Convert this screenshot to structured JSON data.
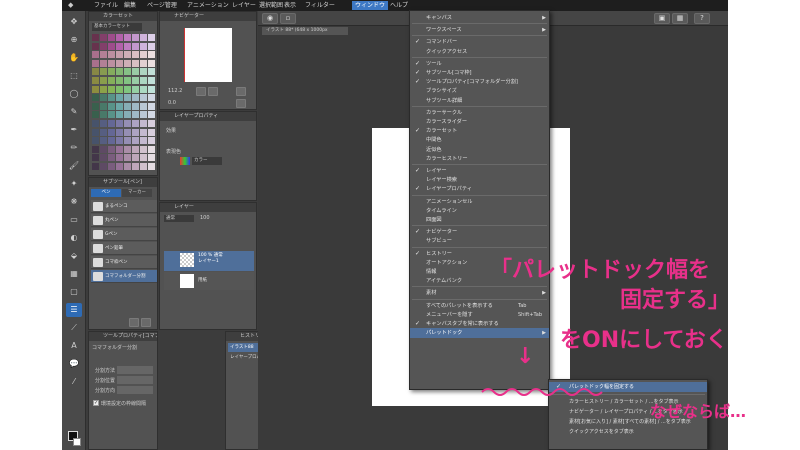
{
  "menubar": {
    "items": [
      "ファイル",
      "編集",
      "ページ管理",
      "アニメーション",
      "レイヤー",
      "選択範囲",
      "表示",
      "フィルター",
      "ウィンドウ",
      "ヘルプ"
    ],
    "active_index": 8
  },
  "canvas": {
    "tab_label": "イラスト 88* (648 x 1000px"
  },
  "left_panels": {
    "color_set_title": "カラーセット",
    "color_set_dropdown": "基本カラーセット",
    "sub_tool_title": "サブツール[ペン]",
    "sub_tool_tabs": [
      "ペン",
      "マーカー"
    ],
    "sub_tool_items": [
      "まるペンコ",
      "丸ペン",
      "Gペン",
      "ペン鉛筆",
      "コマ枠ペン",
      "コマフォルダー分割"
    ],
    "tool_property_title": "ツールプロパティ[コマフォルダー分割]",
    "tool_property_name": "コマフォルダー分割",
    "tool_property_rows": [
      "分割方法",
      "分割位置",
      "分割方向"
    ],
    "tool_property_checkbox": "環境設定の枠線間隔",
    "navigator_title": "ナビゲーター",
    "zoom_value": "112.2",
    "rotation_value": "0.0",
    "layer_property_title": "レイヤープロパティ",
    "layer_property_labels": [
      "効果",
      "表現色"
    ],
    "layer_property_color": "カラー",
    "layer_title": "レイヤー",
    "layer_blend": "通常",
    "layer_opacity": "100",
    "layers": [
      {
        "name": "100 % 通常\nレイヤー1"
      },
      {
        "name": "用紙"
      }
    ],
    "history_title": "ヒストリー",
    "history_items": [
      "イラスト88",
      "レイヤープロパティの変更"
    ]
  },
  "window_menu": {
    "items": [
      {
        "label": "キャンバス",
        "checked": false,
        "submenu": true
      },
      {
        "sep": true
      },
      {
        "label": "ワークスペース",
        "checked": false,
        "submenu": true
      },
      {
        "sep": true
      },
      {
        "label": "コマンドバー",
        "checked": true
      },
      {
        "label": "クイックアクセス",
        "checked": false
      },
      {
        "sep": true
      },
      {
        "label": "ツール",
        "checked": true
      },
      {
        "label": "サブツール[コマ枠]",
        "checked": true
      },
      {
        "label": "ツールプロパティ[コマフォルダー分割]",
        "checked": true
      },
      {
        "label": "ブラシサイズ",
        "checked": false
      },
      {
        "label": "サブツール詳細",
        "checked": false
      },
      {
        "sep": true
      },
      {
        "label": "カラーサークル",
        "checked": false
      },
      {
        "label": "カラースライダー",
        "checked": false
      },
      {
        "label": "カラーセット",
        "checked": true
      },
      {
        "label": "中間色",
        "checked": false
      },
      {
        "label": "近似色",
        "checked": false
      },
      {
        "label": "カラーヒストリー",
        "checked": false
      },
      {
        "sep": true
      },
      {
        "label": "レイヤー",
        "checked": true
      },
      {
        "label": "レイヤー検索",
        "checked": false
      },
      {
        "label": "レイヤープロパティ",
        "checked": true
      },
      {
        "sep": true
      },
      {
        "label": "アニメーションセル",
        "checked": false
      },
      {
        "label": "タイムライン",
        "checked": false
      },
      {
        "label": "四面図",
        "checked": false
      },
      {
        "sep": true
      },
      {
        "label": "ナビゲーター",
        "checked": true
      },
      {
        "label": "サブビュー",
        "checked": false
      },
      {
        "sep": true
      },
      {
        "label": "ヒストリー",
        "checked": true
      },
      {
        "label": "オートアクション",
        "checked": false
      },
      {
        "label": "情報",
        "checked": false
      },
      {
        "label": "アイテムバンク",
        "checked": false
      },
      {
        "sep": true
      },
      {
        "label": "素材",
        "checked": false,
        "submenu": true
      },
      {
        "sep": true
      },
      {
        "label": "すべてのパレットを表示する",
        "checked": false,
        "shortcut": "Tab"
      },
      {
        "label": "メニューバーを隠す",
        "checked": false,
        "shortcut": "Shift+Tab"
      },
      {
        "label": "キャンバスタブを常に表示する",
        "checked": true
      },
      {
        "label": "パレットドック",
        "checked": false,
        "submenu": true,
        "highlighted": true
      }
    ]
  },
  "palette_dock_submenu": {
    "items": [
      {
        "label": "パレットドック幅を固定する",
        "checked": true,
        "highlighted": true
      },
      {
        "sep": true
      },
      {
        "label": "カラーヒストリー / カラーセット / ...をタブ表示"
      },
      {
        "label": "ナビゲーター / レイヤープロパティ / ...をタブ表示"
      },
      {
        "label": "素材[お気に入り] / 素材[すべての素材] / ...をタブ表示"
      },
      {
        "label": "クイックアクセスをタブ表示"
      }
    ]
  },
  "annotations": {
    "line1": "「パレットドック幅を",
    "line2": "固定する」",
    "line3": "をONにしておく",
    "line4": "なぜならば…",
    "arrow": "↓",
    "color": "#e8308a"
  },
  "colors": {
    "menu_highlight": "#4f6f9a",
    "menubar_active": "#3d78c4",
    "annotation": "#e8308a"
  }
}
